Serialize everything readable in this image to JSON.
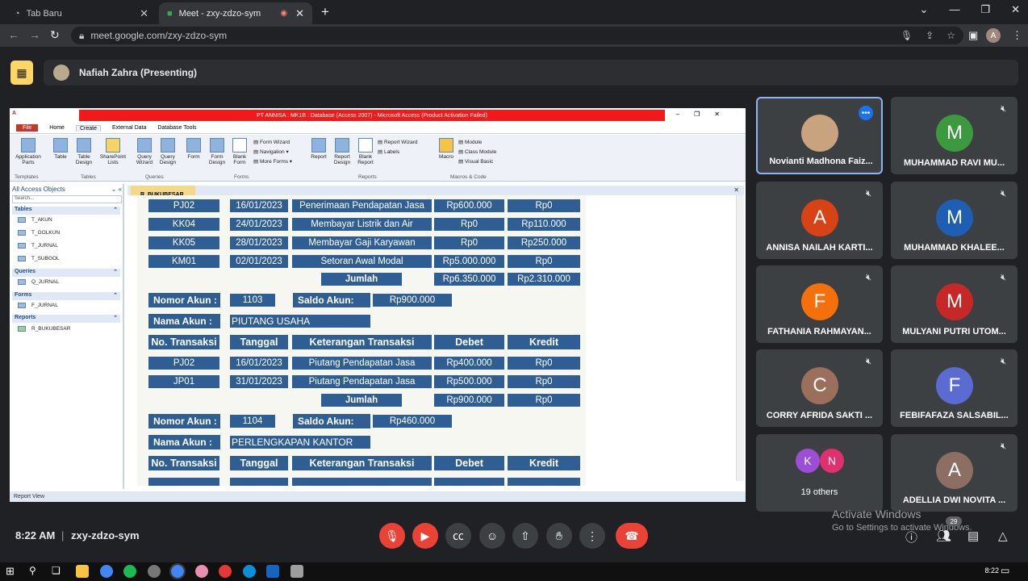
{
  "browser": {
    "tabs": [
      {
        "label": "Tab Baru"
      },
      {
        "label": "Meet - zxy-zdzo-sym"
      }
    ],
    "url": "meet.google.com/zxy-zdzo-sym"
  },
  "meet": {
    "presenter": "Nafiah Zahra (Presenting)",
    "time": "8:22 AM",
    "meeting_code": "zxy-zdzo-sym",
    "others_label": "19 others",
    "participant_count": "29",
    "activate_title": "Activate Windows",
    "activate_sub": "Go to Settings to activate Windows.",
    "taskbar_time": "8:22"
  },
  "participants": [
    {
      "name": "Novianti Madhona Faiz...",
      "initial": "",
      "color": "#c9a27e"
    },
    {
      "name": "MUHAMMAD RAVI MU...",
      "initial": "M",
      "color": "#3c9a3e"
    },
    {
      "name": "ANNISA NAILAH KARTI...",
      "initial": "A",
      "color": "#d84315"
    },
    {
      "name": "MUHAMMAD KHALEE...",
      "initial": "M",
      "color": "#1e5fb3"
    },
    {
      "name": "FATHANIA RAHMAYAN...",
      "initial": "F",
      "color": "#f4700b"
    },
    {
      "name": "MULYANI PUTRI UTOM...",
      "initial": "M",
      "color": "#c62828"
    },
    {
      "name": "CORRY AFRIDA SAKTI ...",
      "initial": "C",
      "color": "#9c6f5c"
    },
    {
      "name": "FEBIFAFAZA SALSABIL...",
      "initial": "F",
      "color": "#5b6bd1"
    },
    {
      "name": "ADELLIA DWI NOVITA ...",
      "initial": "A",
      "color": "#8d6e63"
    }
  ],
  "others_avatars": [
    {
      "initial": "K",
      "color": "#9c4fd6"
    },
    {
      "initial": "N",
      "color": "#e0306d"
    }
  ],
  "access": {
    "window_title": "PT ANNISA : MK1B : Database (Access 2007) - Microsoft Access (Product Activation Failed)",
    "ribbon_tabs": [
      "File",
      "Home",
      "Create",
      "External Data",
      "Database Tools"
    ],
    "ribbon_buttons": [
      "Application Parts",
      "Table",
      "Table Design",
      "SharePoint Lists",
      "Query Wizard",
      "Query Design",
      "Form",
      "Form Design",
      "Blank Form",
      "Report",
      "Report Design",
      "Blank Report",
      "Macro"
    ],
    "ribbon_small": [
      "Form Wizard",
      "Navigation",
      "More Forms",
      "Report Wizard",
      "Labels",
      "Module",
      "Class Module",
      "Visual Basic"
    ],
    "ribbon_groups": [
      "Templates",
      "Tables",
      "Queries",
      "Forms",
      "Reports",
      "Macros & Code"
    ],
    "nav_title": "All Access Objects",
    "nav_search": "Search...",
    "sections": {
      "tables": "Tables",
      "queries": "Queries",
      "forms": "Forms",
      "reports": "Reports"
    },
    "tables": [
      "T_AKUN",
      "T_GOLKUN",
      "T_JURNAL",
      "T_SUBGOL"
    ],
    "queries": [
      "Q_JURNAL"
    ],
    "forms": [
      "F_JURNAL"
    ],
    "reports": [
      "R_BUKUBESAR"
    ],
    "report_tab": "R_BUKUBESAR",
    "status": "Report View"
  },
  "report": {
    "labels": {
      "nomor_akun": "Nomor Akun :",
      "saldo_akun": "Saldo Akun:",
      "nama_akun": "Nama Akun :",
      "jumlah": "Jumlah"
    },
    "headers": [
      "No. Transaksi",
      "Tanggal",
      "Keterangan Transaksi",
      "Debet",
      "Kredit"
    ],
    "block1_rows": [
      [
        "PJ02",
        "16/01/2023",
        "Penerimaan Pendapatan Jasa",
        "Rp600.000",
        "Rp0"
      ],
      [
        "KK04",
        "24/01/2023",
        "Membayar Listrik dan Air",
        "Rp0",
        "Rp110.000"
      ],
      [
        "KK05",
        "28/01/2023",
        "Membayar Gaji Karyawan",
        "Rp0",
        "Rp250.000"
      ],
      [
        "KM01",
        "02/01/2023",
        "Setoran Awal Modal",
        "Rp5.000.000",
        "Rp0"
      ]
    ],
    "block1_total": [
      "Rp6.350.000",
      "Rp2.310.000"
    ],
    "block2": {
      "nomor": "1103",
      "saldo": "Rp900.000",
      "nama": "PIUTANG USAHA",
      "rows": [
        [
          "PJ02",
          "16/01/2023",
          "Piutang Pendapatan Jasa",
          "Rp400.000",
          "Rp0"
        ],
        [
          "JP01",
          "31/01/2023",
          "Piutang Pendapatan Jasa",
          "Rp500.000",
          "Rp0"
        ]
      ],
      "total": [
        "Rp900.000",
        "Rp0"
      ]
    },
    "block3": {
      "nomor": "1104",
      "saldo": "Rp460.000",
      "nama": "PERLENGKAPAN KANTOR"
    }
  }
}
